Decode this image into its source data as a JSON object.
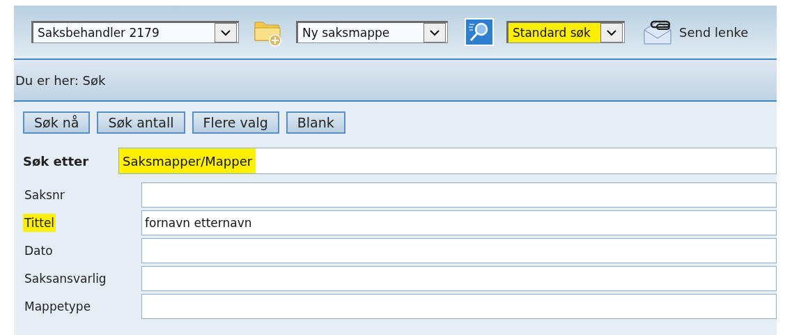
{
  "toolbar": {
    "user_select": {
      "value": "Saksbehandler 2179"
    },
    "folder_select": {
      "value": "Ny saksmappe"
    },
    "search_select": {
      "value": "Standard søk",
      "highlighted": true
    },
    "send_link": {
      "label": "Send lenke"
    }
  },
  "breadcrumb": {
    "text": "Du er her: Søk"
  },
  "buttons": [
    "Søk nå",
    "Søk antall",
    "Flere valg",
    "Blank"
  ],
  "search_for": {
    "label": "Søk etter",
    "value": "Saksmapper/Mapper",
    "highlighted": true
  },
  "fields": [
    {
      "label": "Saksnr",
      "highlighted": false
    },
    {
      "label": "Tittel",
      "value": "fornavn etternavn",
      "highlighted": true
    },
    {
      "label": "Dato",
      "highlighted": false
    },
    {
      "label": "Saksansvarlig",
      "highlighted": false
    },
    {
      "label": "Mappetype",
      "highlighted": false
    }
  ]
}
